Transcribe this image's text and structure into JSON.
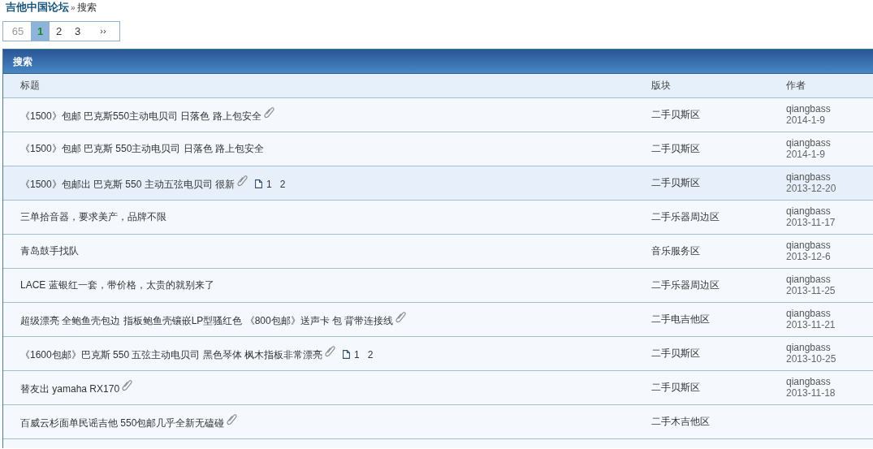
{
  "breadcrumb": {
    "site": "吉他中国论坛",
    "separator": "»",
    "current": "搜索"
  },
  "pagination": [
    {
      "label": "65",
      "kind": "total"
    },
    {
      "label": "1",
      "kind": "page",
      "selected": true
    },
    {
      "label": "2",
      "kind": "page",
      "selected": false
    },
    {
      "label": "3",
      "kind": "page",
      "selected": false
    },
    {
      "label": "››",
      "kind": "next"
    }
  ],
  "panel": {
    "title": "搜索"
  },
  "table": {
    "columns": [
      "标题",
      "版块",
      "作者"
    ],
    "rows": [
      {
        "title": "《1500》包邮 巴克斯550主动电贝司 日落色 路上包安全",
        "attachment": true,
        "pages": [],
        "forum": "二手贝斯区",
        "author": "qiangbass",
        "date": "2014-1-9",
        "highlighted": false
      },
      {
        "title": "《1500》包邮 巴克斯 550主动电贝司 日落色 路上包安全",
        "attachment": false,
        "pages": [],
        "forum": "二手贝斯区",
        "author": "qiangbass",
        "date": "2014-1-9",
        "highlighted": false
      },
      {
        "title": "《1500》包邮出 巴克斯 550 主动五弦电贝司 很新",
        "attachment": true,
        "pages": [
          "1",
          "2"
        ],
        "forum": "二手贝斯区",
        "author": "qiangbass",
        "date": "2013-12-20",
        "highlighted": true
      },
      {
        "title": "三单拾音器，要求美产，品牌不限",
        "attachment": false,
        "pages": [],
        "forum": "二手乐器周边区",
        "author": "qiangbass",
        "date": "2013-11-17",
        "highlighted": false
      },
      {
        "title": "青岛鼓手找队",
        "attachment": false,
        "pages": [],
        "forum": "音乐服务区",
        "author": "qiangbass",
        "date": "2013-12-6",
        "highlighted": false
      },
      {
        "title": "LACE 蓝银红一套，带价格，太贵的就别来了",
        "attachment": false,
        "pages": [],
        "forum": "二手乐器周边区",
        "author": "qiangbass",
        "date": "2013-11-25",
        "highlighted": false
      },
      {
        "title": "超级漂亮 全鲍鱼壳包边 指板鲍鱼壳镶嵌LP型骚红色 《800包邮》送声卡 包 背带连接线",
        "attachment": true,
        "pages": [],
        "forum": "二手电吉他区",
        "author": "qiangbass",
        "date": "2013-11-21",
        "highlighted": false
      },
      {
        "title": "《1600包邮》巴克斯 550 五弦主动电贝司 黑色琴体 枫木指板非常漂亮",
        "attachment": true,
        "pages": [
          "1",
          "2"
        ],
        "forum": "二手贝斯区",
        "author": "qiangbass",
        "date": "2013-10-25",
        "highlighted": false
      },
      {
        "title": "替友出 yamaha RX170",
        "attachment": true,
        "pages": [],
        "forum": "二手贝斯区",
        "author": "qiangbass",
        "date": "2013-11-18",
        "highlighted": false
      },
      {
        "title": "百威云杉面单民谣吉他 550包邮几乎全新无磕碰",
        "attachment": true,
        "pages": [],
        "forum": "二手木吉他区",
        "highlighted": false
      }
    ]
  }
}
